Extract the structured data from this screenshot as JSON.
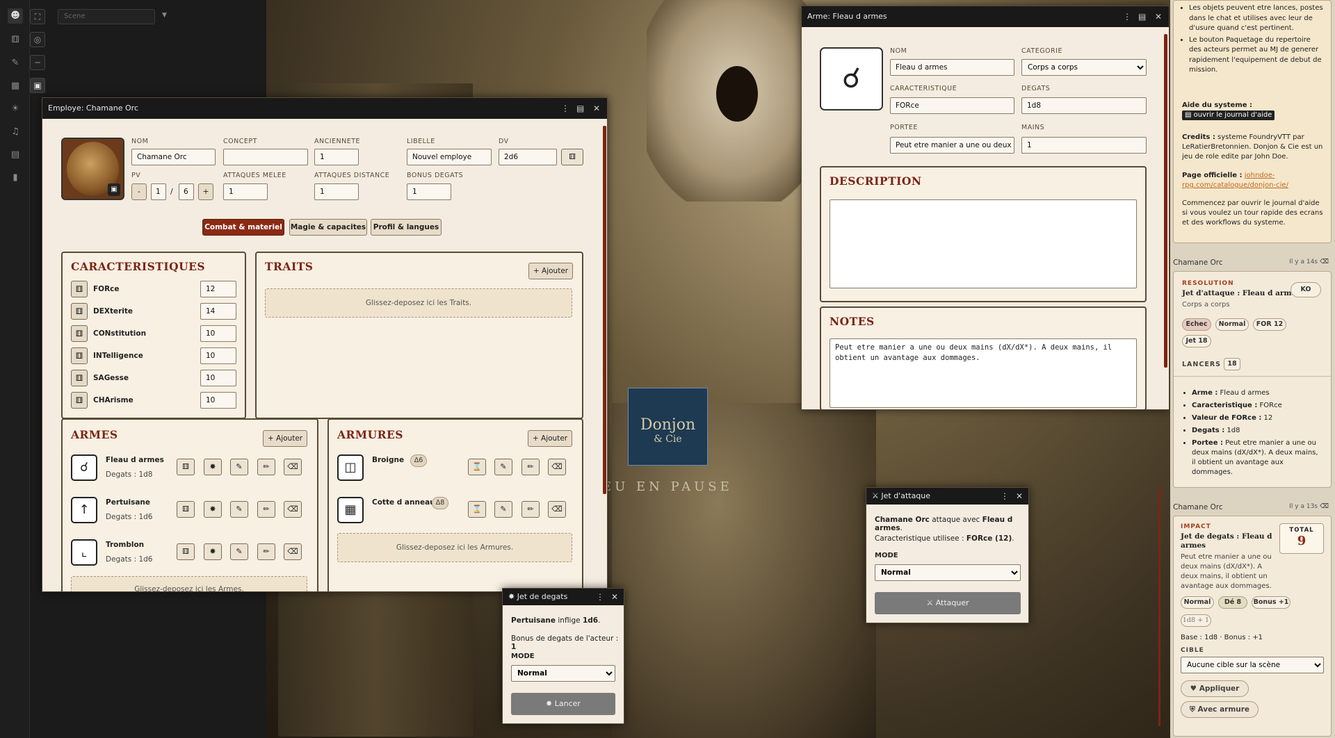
{
  "colors": {
    "accent": "#8b2a14",
    "parchment": "#f4ece0",
    "dark": "#191919",
    "orange_link": "#c06a1a"
  },
  "toolbar": {
    "icons": [
      "user-icon",
      "dice-icon",
      "target-icon",
      "pencil-icon",
      "ruler-icon",
      "grid-icon",
      "bag-icon",
      "lightbulb-icon",
      "music-icon",
      "map-icon",
      "bookmark-icon"
    ]
  },
  "scene": {
    "placeholder": "Scene"
  },
  "canvas": {
    "logo_line1": "Donjon",
    "logo_line2": "& Cie",
    "paused": "EU EN PAUSE"
  },
  "actor": {
    "title": "Employe: Chamane Orc",
    "labels": {
      "nom": "NOM",
      "concept": "CONCEPT",
      "anciennete": "ANCIENNETE",
      "libelle": "LIBELLE",
      "dv": "DV",
      "pv": "PV",
      "attaques_melee": "ATTAQUES MELEE",
      "attaques_distance": "ATTAQUES DISTANCE",
      "bonus_degats": "BONUS DEGATS"
    },
    "values": {
      "nom": "Chamane Orc",
      "concept": "",
      "anciennete": "1",
      "libelle": "Nouvel employe",
      "dv": "2d6",
      "pv_current": "1",
      "pv_max": "6",
      "pv_sep": "/",
      "attaques_melee": "1",
      "attaques_distance": "1",
      "bonus_degats": "1"
    },
    "pv_minus": "-",
    "pv_plus": "+",
    "tabs": [
      "Combat & materiel",
      "Magie & capacites",
      "Profil & langues"
    ],
    "caracteristiques": {
      "title": "CARACTERISTIQUES",
      "items": [
        {
          "label": "FORce",
          "value": "12"
        },
        {
          "label": "DEXterite",
          "value": "14"
        },
        {
          "label": "CONstitution",
          "value": "10"
        },
        {
          "label": "INTelligence",
          "value": "10"
        },
        {
          "label": "SAGesse",
          "value": "10"
        },
        {
          "label": "CHArisme",
          "value": "10"
        }
      ]
    },
    "traits": {
      "title": "TRAITS",
      "add": "+ Ajouter",
      "drop": "Glissez-deposez ici les Traits."
    },
    "armes": {
      "title": "ARMES",
      "add": "+ Ajouter",
      "drop": "Glissez-deposez ici les Armes.",
      "items": [
        {
          "name": "Fleau d armes",
          "sub": "Degats : 1d8",
          "icon": "flail-icon"
        },
        {
          "name": "Pertuisane",
          "sub": "Degats : 1d6",
          "icon": "polearm-icon"
        },
        {
          "name": "Tromblon",
          "sub": "Degats : 1d6",
          "icon": "gun-icon"
        }
      ]
    },
    "armures": {
      "title": "ARMURES",
      "add": "+ Ajouter",
      "drop": "Glissez-deposez ici les Armures.",
      "items": [
        {
          "name": "Broigne",
          "badge": "Δ6"
        },
        {
          "name": "Cotte d anneaux",
          "badge": "Δ8"
        }
      ]
    }
  },
  "item": {
    "title": "Arme: Fleau d armes",
    "labels": {
      "nom": "NOM",
      "categorie": "CATEGORIE",
      "caracteristique": "CARACTERISTIQUE",
      "degats": "DEGATS",
      "portee": "PORTEE",
      "mains": "MAINS"
    },
    "values": {
      "nom": "Fleau d armes",
      "categorie": "Corps a corps",
      "caracteristique": "FORce",
      "degats": "1d8",
      "portee": "Peut etre manier a une ou deux mains",
      "mains": "1"
    },
    "description_title": "DESCRIPTION",
    "notes_title": "NOTES",
    "notes": "Peut etre manier a une ou deux mains (dX/dX*). A deux mains, il obtient un avantage aux dommages."
  },
  "attack": {
    "title": "Jet d'attaque",
    "actor": "Chamane Orc",
    "mid": " attaque avec ",
    "weapon": "Fleau d armes",
    "end": ".",
    "carac_label": "Caracteristique utilisee : ",
    "carac_value": "FORce (12)",
    "carac_end": ".",
    "mode_label": "MODE",
    "mode": "Normal",
    "button": "Attaquer"
  },
  "damage": {
    "title": "Jet de degats",
    "weapon": "Pertuisane",
    "inflige": " inflige ",
    "dice": "1d6",
    "end": ".",
    "bonus_label": "Bonus de degats de l'acteur : ",
    "bonus": "1",
    "mode_label": "MODE",
    "mode": "Normal",
    "button": "Lancer"
  },
  "sidebar": {
    "help": {
      "bullet1": "Les objets peuvent etre lances, postes dans le chat et utilises avec leur de d'usure quand c'est pertinent.",
      "bullet2": "Le bouton Paquetage du repertoire des acteurs permet au MJ de generer rapidement l'equipement de debut de mission.",
      "aide_label": "Aide du systeme :",
      "aide_button": "ouvrir le journal d'aide",
      "credits_label": "Credits :",
      "credits": " systeme FoundryVTT par LeRatierBretonnien. Donjon & Cie est un jeu de role edite par John Doe.",
      "page_label": "Page officielle :",
      "page_link": "johndoe-rpg.com/catalogue/donjon-cie/",
      "start": "Commencez par ouvrir le journal d'aide si vous voulez un tour rapide des ecrans et des workflows du systeme."
    },
    "msg1": {
      "speaker": "Chamane Orc",
      "time": "Il y a 14s",
      "kicker": "RESOLUTION",
      "title": "Jet d'attaque : Fleau d armes",
      "sub": "Corps a corps",
      "ko": "KO",
      "chips": [
        "Echec",
        "Normal",
        "FOR 12",
        "Jet 18"
      ],
      "lancers_label": "LANCERS",
      "lancers": "18",
      "lines": [
        {
          "k": "Arme :",
          "v": " Fleau d armes"
        },
        {
          "k": "Caracteristique :",
          "v": " FORce"
        },
        {
          "k": "Valeur de FORce :",
          "v": " 12"
        },
        {
          "k": "Degats :",
          "v": " 1d8"
        },
        {
          "k": "Portee :",
          "v": " Peut etre manier a une ou deux mains (dX/dX*). A deux mains, il obtient un avantage aux dommages."
        }
      ]
    },
    "msg2": {
      "speaker": "Chamane Orc",
      "time": "Il y a 13s",
      "kicker": "IMPACT",
      "title": "Jet de degats : Fleau d armes",
      "total_label": "TOTAL",
      "total": "9",
      "desc": "Peut etre manier a une ou deux mains (dX/dX*). A deux mains, il obtient un avantage aux dommages.",
      "chips": [
        "Normal",
        "Dé 8",
        "Bonus +1"
      ],
      "formula": "1d8 + 1",
      "base": "Base : 1d8 · Bonus : +1",
      "cible_label": "CIBLE",
      "cible": "Aucune cible sur la scène",
      "apply": "Appliquer",
      "armor": "Avec armure"
    }
  }
}
